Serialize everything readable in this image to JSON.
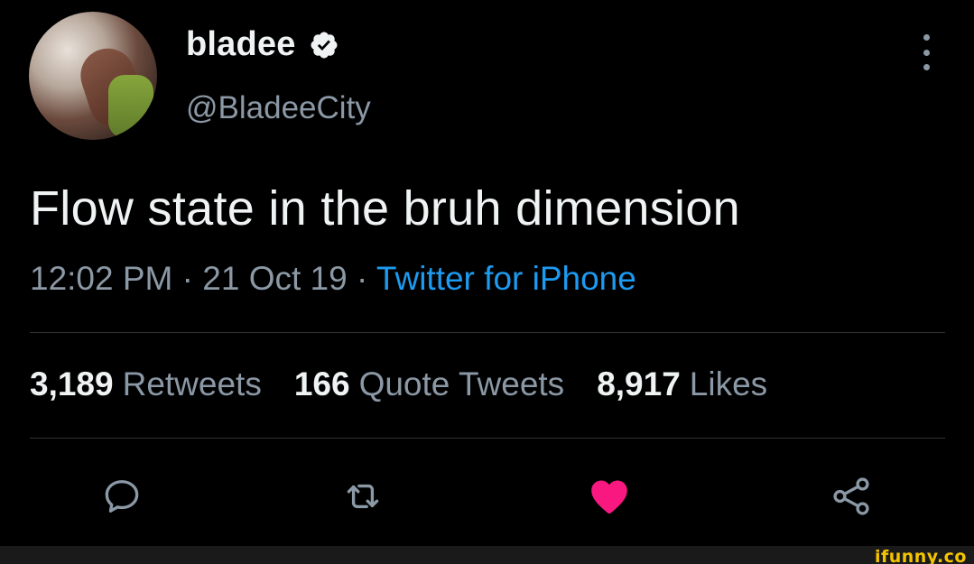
{
  "user": {
    "name": "bladee",
    "handle": "@BladeeCity",
    "verified": true
  },
  "tweet": {
    "text": "Flow state in the bruh dimension",
    "time": "12:02 PM",
    "separator": " · ",
    "date": "21 Oct 19",
    "source": "Twitter for iPhone"
  },
  "stats": {
    "retweets_count": "3,189",
    "retweets_label": "Retweets",
    "quotes_count": "166",
    "quotes_label": "Quote Tweets",
    "likes_count": "8,917",
    "likes_label": "Likes"
  },
  "actions": {
    "reply_icon": "reply-icon",
    "retweet_icon": "retweet-icon",
    "like_icon": "heart-icon",
    "share_icon": "share-icon",
    "liked": true
  },
  "colors": {
    "accent": "#1d9bf0",
    "like": "#f91880",
    "watermark": "#f5c400"
  },
  "watermark": "ifunny.co"
}
